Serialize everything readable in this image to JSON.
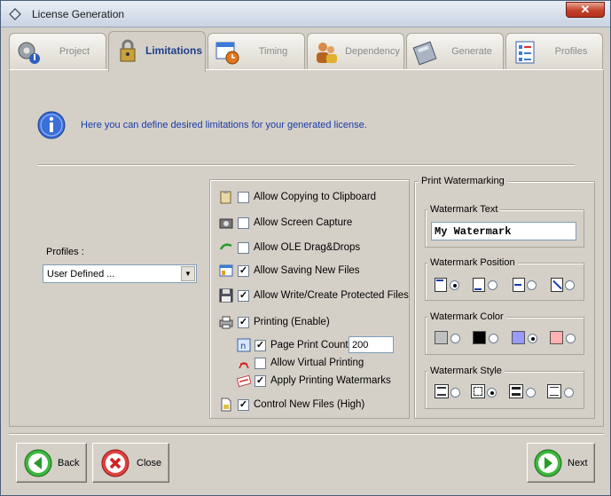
{
  "window": {
    "title": "License Generation",
    "close_glyph": "✕"
  },
  "tabs": [
    {
      "label": "Project",
      "icon": "gear-icon"
    },
    {
      "label": "Limitations",
      "icon": "lock-icon",
      "active": true
    },
    {
      "label": "Timing",
      "icon": "calendar-clock-icon"
    },
    {
      "label": "Dependency",
      "icon": "users-icon"
    },
    {
      "label": "Generate",
      "icon": "calculator-icon"
    },
    {
      "label": "Profiles",
      "icon": "checklist-icon"
    }
  ],
  "info": {
    "text": "Here you can define desired limitations for your generated license."
  },
  "profiles": {
    "label": "Profiles :",
    "selected": "User Defined ..."
  },
  "options": [
    {
      "label": "Allow Copying to Clipboard",
      "checked": false,
      "check_glyph": ""
    },
    {
      "label": "Allow Screen Capture",
      "checked": false,
      "check_glyph": ""
    },
    {
      "label": "Allow OLE Drag&Drops",
      "checked": false,
      "check_glyph": ""
    },
    {
      "label": "Allow Saving New Files",
      "checked": true,
      "check_glyph": "✓"
    },
    {
      "label": "Allow Write/Create Protected Files",
      "checked": true,
      "check_glyph": "✓"
    },
    {
      "label": "Printing (Enable)",
      "checked": true,
      "check_glyph": "✓"
    },
    {
      "label": "Page Print Count",
      "checked": true,
      "check_glyph": "✓",
      "value": "200"
    },
    {
      "label": "Allow Virtual Printing",
      "checked": false,
      "check_glyph": ""
    },
    {
      "label": "Apply Printing Watermarks",
      "checked": true,
      "check_glyph": "✓"
    },
    {
      "label": "Control New Files (High)",
      "checked": true,
      "check_glyph": "✓"
    }
  ],
  "watermark": {
    "group_title": "Print Watermarking",
    "text_title": "Watermark Text",
    "text_value": "My Watermark",
    "position_title": "Watermark Position",
    "position_selected": 0,
    "color_title": "Watermark Color",
    "colors": [
      "#c0c0c0",
      "#000000",
      "#9999ff",
      "#ffb0b0"
    ],
    "color_selected": 2,
    "style_title": "Watermark Style",
    "style_selected": 1
  },
  "buttons": {
    "back": "Back",
    "close": "Close",
    "next": "Next"
  },
  "colors": {
    "accent": "#1f3f8a",
    "info_text": "#1a3aa8",
    "window_bg": "#d4d0c8"
  }
}
